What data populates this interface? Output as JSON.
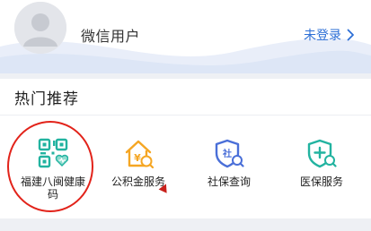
{
  "user": {
    "name": "微信用户",
    "login_label": "未登录",
    "avatar_icon": "user-silhouette-icon",
    "chevron_icon": "chevron-right-icon"
  },
  "hot": {
    "title": "热门推荐",
    "items": [
      {
        "label": "福建八闽健康码",
        "icon": "qr-health-code-icon",
        "color": "#22b3a0",
        "highlighted": true
      },
      {
        "label": "公积金服务",
        "icon": "housing-fund-icon",
        "color": "#f5a623"
      },
      {
        "label": "社保查询",
        "icon": "social-security-shield-icon",
        "color": "#4a6fd8"
      },
      {
        "label": "医保服务",
        "icon": "medical-insurance-shield-icon",
        "color": "#22b3a0"
      }
    ]
  },
  "colors": {
    "accent": "#2d6fd6",
    "highlight_ring": "#e2231a"
  }
}
